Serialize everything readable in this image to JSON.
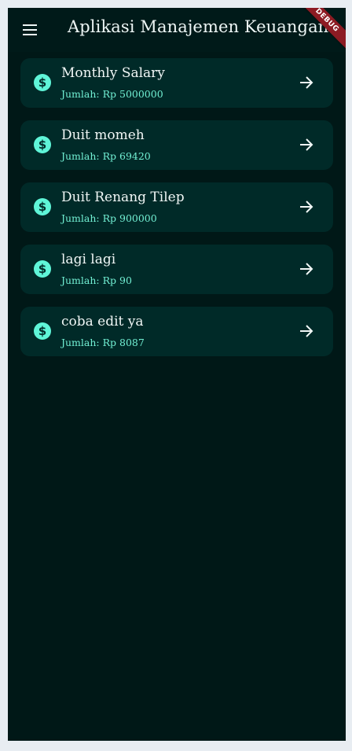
{
  "appbar": {
    "title": "Aplikasi Manajemen Keuangan",
    "menu_icon": "menu-icon",
    "debug_badge": "DEBUG"
  },
  "transactions": [
    {
      "title": "Monthly Salary",
      "amount": "Jumlah: Rp 5000000"
    },
    {
      "title": "Duit momeh",
      "amount": "Jumlah: Rp 69420"
    },
    {
      "title": "Duit Renang Tilep",
      "amount": "Jumlah: Rp 900000"
    },
    {
      "title": "lagi lagi",
      "amount": "Jumlah: Rp 90"
    },
    {
      "title": "coba edit ya",
      "amount": "Jumlah: Rp 8087"
    }
  ],
  "icons": {
    "item": "dollar-coin-icon",
    "action": "arrow-right-icon"
  },
  "colors": {
    "background": "#001817",
    "card": "#002a28",
    "accent": "#5ff5d8",
    "subtitle": "#72f0d4",
    "debug_ribbon": "#8d1b23"
  }
}
